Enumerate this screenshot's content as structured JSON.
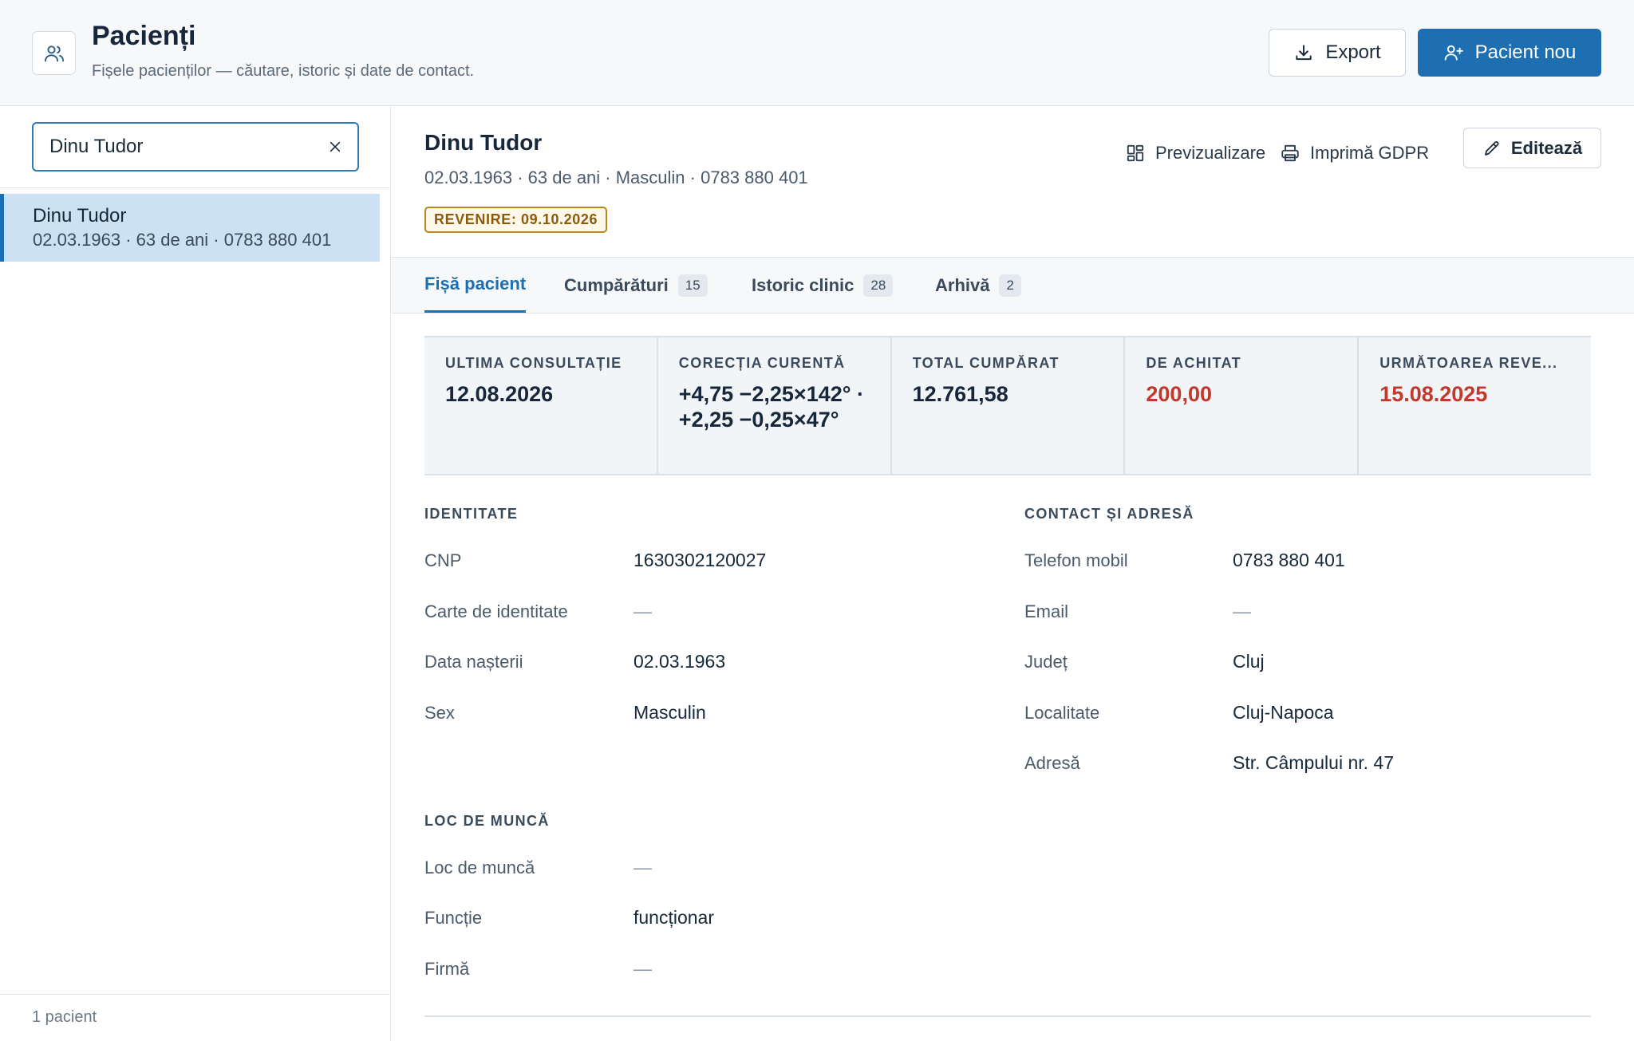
{
  "header": {
    "title": "Pacienți",
    "subtitle": "Fișele pacienților — căutare, istoric și date de contact.",
    "export_label": "Export",
    "new_patient_label": "Pacient nou"
  },
  "sidebar": {
    "search_value": "Dinu Tudor",
    "results": [
      {
        "name": "Dinu Tudor",
        "meta": "02.03.1963 · 63 de ani · 0783 880 401"
      }
    ],
    "count_label": "1 pacient"
  },
  "patient": {
    "name": "Dinu Tudor",
    "meta": "02.03.1963 · 63 de ani · Masculin · 0783 880 401",
    "badge": "REVENIRE: 09.10.2026",
    "actions": {
      "preview": "Previzualizare",
      "print": "Imprimă GDPR",
      "edit": "Editează"
    }
  },
  "tabs": [
    {
      "label": "Fișă pacient",
      "count": ""
    },
    {
      "label": "Cumpărături",
      "count": "15"
    },
    {
      "label": "Istoric clinic",
      "count": "28"
    },
    {
      "label": "Arhivă",
      "count": "2"
    }
  ],
  "stats": [
    {
      "label": "ULTIMA CONSULTAȚIE",
      "value": "12.08.2026"
    },
    {
      "label": "CORECȚIA CURENTĂ",
      "value": "+4,75 −2,25×142° · +2,25 −0,25×47°"
    },
    {
      "label": "TOTAL CUMPĂRAT",
      "value": "12.761,58"
    },
    {
      "label": "DE ACHITAT",
      "value": "200,00"
    },
    {
      "label": "URMĂTOAREA REVE...",
      "value": "15.08.2025"
    }
  ],
  "identity": {
    "title": "IDENTITATE",
    "fields": [
      {
        "label": "CNP",
        "value": "1630302120027"
      },
      {
        "label": "Carte de identitate",
        "value": "—"
      },
      {
        "label": "Data nașterii",
        "value": "02.03.1963"
      },
      {
        "label": "Sex",
        "value": "Masculin"
      }
    ]
  },
  "contact": {
    "title": "CONTACT ȘI ADRESĂ",
    "fields": [
      {
        "label": "Telefon mobil",
        "value": "0783 880 401"
      },
      {
        "label": "Email",
        "value": "—"
      },
      {
        "label": "Județ",
        "value": "Cluj"
      },
      {
        "label": "Localitate",
        "value": "Cluj-Napoca"
      },
      {
        "label": "Adresă",
        "value": "Str. Câmpului nr. 47"
      }
    ]
  },
  "work": {
    "title": "LOC DE MUNCĂ",
    "fields": [
      {
        "label": "Loc de muncă",
        "value": "—"
      },
      {
        "label": "Funcție",
        "value": "funcționar"
      },
      {
        "label": "Firmă",
        "value": "—"
      }
    ]
  },
  "colors": {
    "accent": "#1e6fb2",
    "alert": "#c0392b",
    "badge": "#b8861b",
    "selected_row": "#cde1f5"
  }
}
